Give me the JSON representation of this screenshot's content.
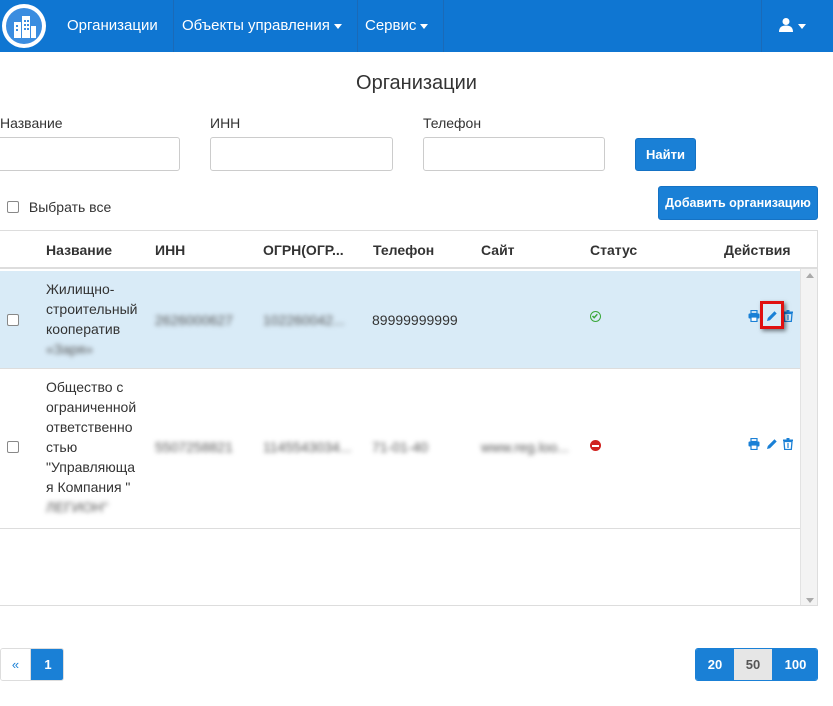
{
  "nav": {
    "items": [
      {
        "label": "Организации",
        "dropdown": false
      },
      {
        "label": "Объекты управления",
        "dropdown": true
      },
      {
        "label": "Сервис",
        "dropdown": true
      }
    ]
  },
  "page": {
    "title": "Организации"
  },
  "filters": {
    "name_label": "Название",
    "inn_label": "ИНН",
    "phone_label": "Телефон",
    "search_button": "Найти"
  },
  "select_all_label": "Выбрать все",
  "add_button": "Добавить организацию",
  "table": {
    "headers": [
      "Название",
      "ИНН",
      "ОГРН(ОГР...",
      "Телефон",
      "Сайт",
      "Статус",
      "Действия"
    ],
    "rows": [
      {
        "name_lines": [
          "Жилищно-",
          "строительный",
          "кооператив",
          "«Заря»"
        ],
        "inn": "2626000627",
        "ogrn": "102260042...",
        "phone": "89999999999",
        "site": "",
        "status": "active"
      },
      {
        "name_lines": [
          "Общество с",
          "ограниченной",
          "ответственно",
          "стью",
          "\"Управляюща",
          "я Компания \"",
          "ЛЕГИОН\""
        ],
        "inn": "5507258821",
        "ogrn": "1145543034...",
        "phone": "71-01-40",
        "site": "www.reg.loo...",
        "status": "blocked"
      }
    ]
  },
  "pagination": {
    "prev": "«",
    "pages": [
      "1"
    ],
    "sizes": [
      "20",
      "50",
      "100"
    ],
    "active_size": "50"
  },
  "colors": {
    "primary": "#0f76d2",
    "selected_row": "#d9ebf7",
    "active_status": "#3aa83a",
    "blocked_status": "#d0221f",
    "highlight": "#e01010"
  }
}
